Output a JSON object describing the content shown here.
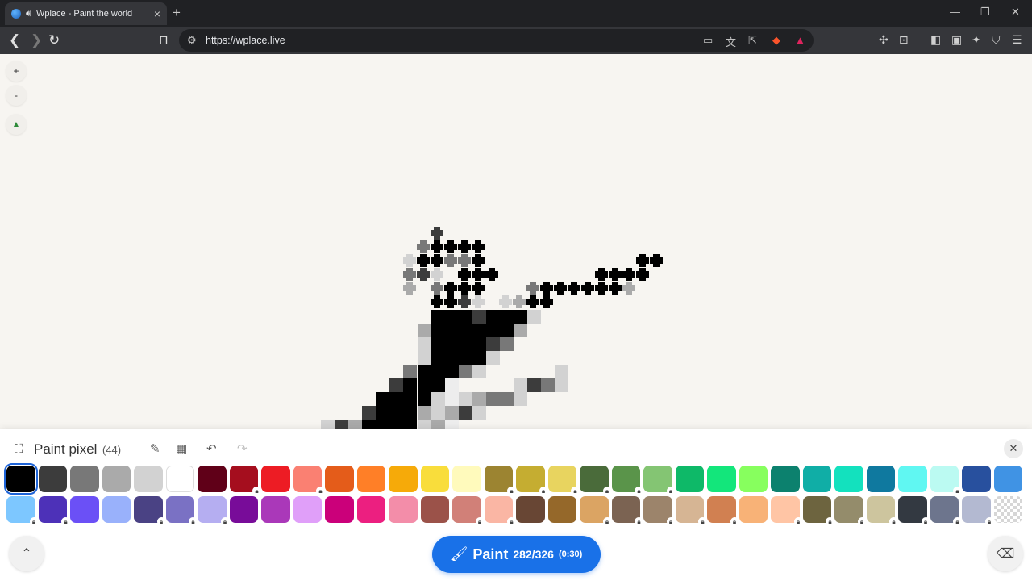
{
  "browser": {
    "tab_title": "Wplace - Paint the world",
    "url": "https://wplace.live"
  },
  "map_controls": {
    "zoom_in": "+",
    "zoom_out": "-"
  },
  "panel": {
    "title": "Paint pixel",
    "count": "(44)",
    "paint_label": "Paint",
    "paint_count": "282/326",
    "paint_cooldown": "(0:30)"
  },
  "palette": [
    {
      "color": "#000000",
      "locked": false,
      "selected": true
    },
    {
      "color": "#3c3c3c",
      "locked": false
    },
    {
      "color": "#787878",
      "locked": false
    },
    {
      "color": "#aaaaaa",
      "locked": false
    },
    {
      "color": "#d2d2d2",
      "locked": false
    },
    {
      "color": "#ffffff",
      "locked": false
    },
    {
      "color": "#600018",
      "locked": false
    },
    {
      "color": "#a50e1e",
      "locked": true
    },
    {
      "color": "#ed1c24",
      "locked": false
    },
    {
      "color": "#fa8072",
      "locked": true
    },
    {
      "color": "#e45c1a",
      "locked": false
    },
    {
      "color": "#ff7f27",
      "locked": false
    },
    {
      "color": "#f6aa09",
      "locked": false
    },
    {
      "color": "#f9dd3b",
      "locked": false
    },
    {
      "color": "#fffabc",
      "locked": false
    },
    {
      "color": "#9c8431",
      "locked": true
    },
    {
      "color": "#c5ad31",
      "locked": true
    },
    {
      "color": "#e8d45f",
      "locked": true
    },
    {
      "color": "#4a6b3a",
      "locked": true
    },
    {
      "color": "#5a944a",
      "locked": true
    },
    {
      "color": "#84c573",
      "locked": true
    },
    {
      "color": "#0eb968",
      "locked": false
    },
    {
      "color": "#13e67b",
      "locked": false
    },
    {
      "color": "#87ff5e",
      "locked": false
    },
    {
      "color": "#0c816e",
      "locked": false
    },
    {
      "color": "#10aea6",
      "locked": false
    },
    {
      "color": "#13e1be",
      "locked": false
    },
    {
      "color": "#0f799f",
      "locked": false
    },
    {
      "color": "#60f7f2",
      "locked": false
    },
    {
      "color": "#bbfaf2",
      "locked": true
    },
    {
      "color": "#28509e",
      "locked": false
    },
    {
      "color": "#4093e4",
      "locked": false
    },
    {
      "color": "#7dc7ff",
      "locked": true
    },
    {
      "color": "#4d31b8",
      "locked": true
    },
    {
      "color": "#6b50f6",
      "locked": false
    },
    {
      "color": "#99b1fb",
      "locked": false
    },
    {
      "color": "#4a4284",
      "locked": true
    },
    {
      "color": "#7a71c4",
      "locked": true
    },
    {
      "color": "#b5aef1",
      "locked": true
    },
    {
      "color": "#780c99",
      "locked": false
    },
    {
      "color": "#aa38b9",
      "locked": false
    },
    {
      "color": "#e09ff9",
      "locked": false
    },
    {
      "color": "#cb007a",
      "locked": false
    },
    {
      "color": "#ec1f80",
      "locked": false
    },
    {
      "color": "#f38da9",
      "locked": false
    },
    {
      "color": "#9b5249",
      "locked": false
    },
    {
      "color": "#d18078",
      "locked": true
    },
    {
      "color": "#fab6a4",
      "locked": true
    },
    {
      "color": "#684634",
      "locked": false
    },
    {
      "color": "#95682a",
      "locked": false
    },
    {
      "color": "#dba463",
      "locked": true
    },
    {
      "color": "#7b6352",
      "locked": true
    },
    {
      "color": "#9c846b",
      "locked": true
    },
    {
      "color": "#d6b594",
      "locked": true
    },
    {
      "color": "#d18051",
      "locked": true
    },
    {
      "color": "#f8b277",
      "locked": false
    },
    {
      "color": "#ffc5a5",
      "locked": true
    },
    {
      "color": "#6d643f",
      "locked": true
    },
    {
      "color": "#948c6b",
      "locked": true
    },
    {
      "color": "#cdc59e",
      "locked": true
    },
    {
      "color": "#333941",
      "locked": true
    },
    {
      "color": "#6d758d",
      "locked": true
    },
    {
      "color": "#b3b9d1",
      "locked": true
    },
    {
      "color": "transparent",
      "locked": false
    }
  ]
}
